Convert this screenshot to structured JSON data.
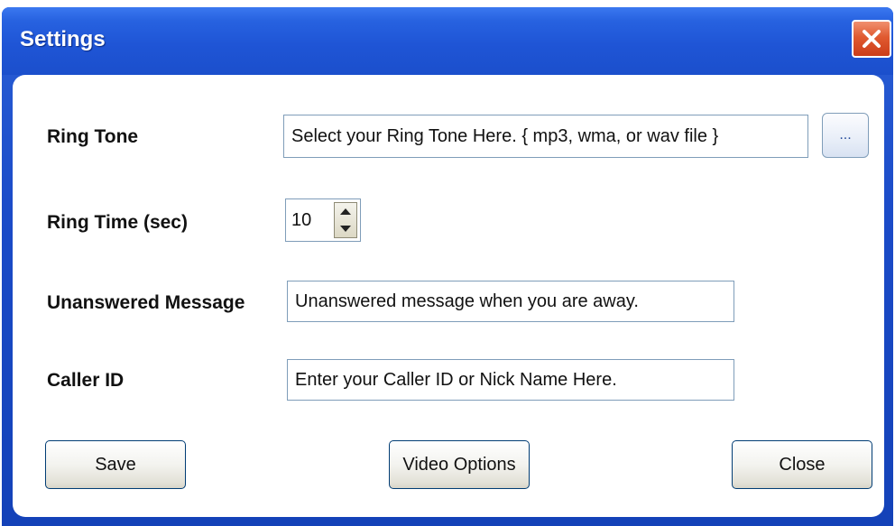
{
  "window": {
    "title": "Settings"
  },
  "form": {
    "ring_tone": {
      "label": "Ring Tone",
      "value": "Select your Ring Tone Here. { mp3, wma, or wav file }",
      "browse_label": "..."
    },
    "ring_time": {
      "label": "Ring Time (sec)",
      "value": "10"
    },
    "unanswered_message": {
      "label": "Unanswered Message",
      "value": "Unanswered message when you are away."
    },
    "caller_id": {
      "label": "Caller ID",
      "value": "Enter your Caller ID or Nick Name Here."
    }
  },
  "buttons": {
    "save": "Save",
    "video_options": "Video Options",
    "close": "Close"
  },
  "icons": {
    "close": "close-x-icon",
    "spin_up": "arrow-up-icon",
    "spin_down": "arrow-down-icon"
  },
  "colors": {
    "titlebar": "#2762e0",
    "close_button": "#e05a30",
    "field_border": "#7f9db9"
  }
}
